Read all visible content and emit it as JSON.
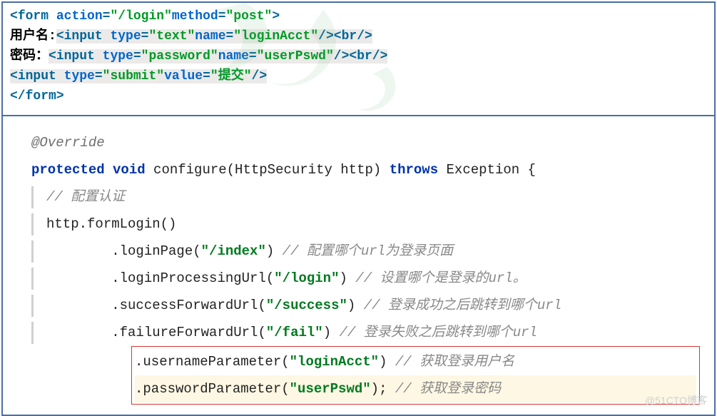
{
  "html_block": {
    "line1": {
      "open": "<",
      "tag": "form",
      "sp": " ",
      "attr1": "action",
      "eq1": "=",
      "val1": "\"/login\"",
      "attr2": "method",
      "eq2": "=",
      "val2": "\"post\"",
      "close": ">"
    },
    "line2": {
      "prefix": "用户名:",
      "open": "<",
      "tag": "input",
      "sp": " ",
      "attr1": "type",
      "eq1": "=",
      "val1": "\"text\"",
      "attr2": "name",
      "eq2": "=",
      "val2": "\"loginAcct\"",
      "selfclose": "/>",
      "br_open": "<",
      "br_tag": "br",
      "br_close": "/>"
    },
    "line3": {
      "prefix": "密码：",
      "open": "<",
      "tag": "input",
      "sp": " ",
      "attr1": "type",
      "eq1": "=",
      "val1": "\"password\"",
      "attr2": "name",
      "eq2": "=",
      "val2": "\"userPswd\"",
      "selfclose": "/>",
      "br_open": "<",
      "br_tag": "br",
      "br_close": "/>"
    },
    "line4": {
      "open": "<",
      "tag": "input",
      "sp": " ",
      "attr1": "type",
      "eq1": "=",
      "val1": "\"submit\"",
      "attr2": "value",
      "eq2": "=",
      "val2": "\"提交\"",
      "selfclose": "/>"
    },
    "line5": {
      "open": "</",
      "tag": "form",
      "close": ">"
    }
  },
  "java_block": {
    "annot": "@Override",
    "sig": {
      "kw1": "protected",
      "kw2": "void",
      "name": " configure(HttpSecurity http) ",
      "kw3": "throws",
      "tail": " Exception {"
    },
    "c1": "// 配置认证",
    "l2": "http.formLogin()",
    "l3_a": ".loginPage(",
    "l3_s": "\"/index\"",
    "l3_b": ") ",
    "l3_c": "// 配置哪个url为登录页面",
    "l4_a": ".loginProcessingUrl(",
    "l4_s": "\"/login\"",
    "l4_b": ") ",
    "l4_c": "// 设置哪个是登录的url。",
    "l5_a": ".successForwardUrl(",
    "l5_s": "\"/success\"",
    "l5_b": ") ",
    "l5_c": "// 登录成功之后跳转到哪个url",
    "l6_a": ".failureForwardUrl(",
    "l6_s": "\"/fail\"",
    "l6_b": ") ",
    "l6_c": "// 登录失败之后跳转到哪个url",
    "l7_a": ".usernameParameter(",
    "l7_s": "\"loginAcct\"",
    "l7_b": ") ",
    "l7_c": "// 获取登录用户名",
    "l8_a": ".passwordParameter(",
    "l8_s": "\"userPswd\"",
    "l8_b": "); ",
    "l8_c": "// 获取登录密码"
  },
  "watermark": "@51CTO博客"
}
